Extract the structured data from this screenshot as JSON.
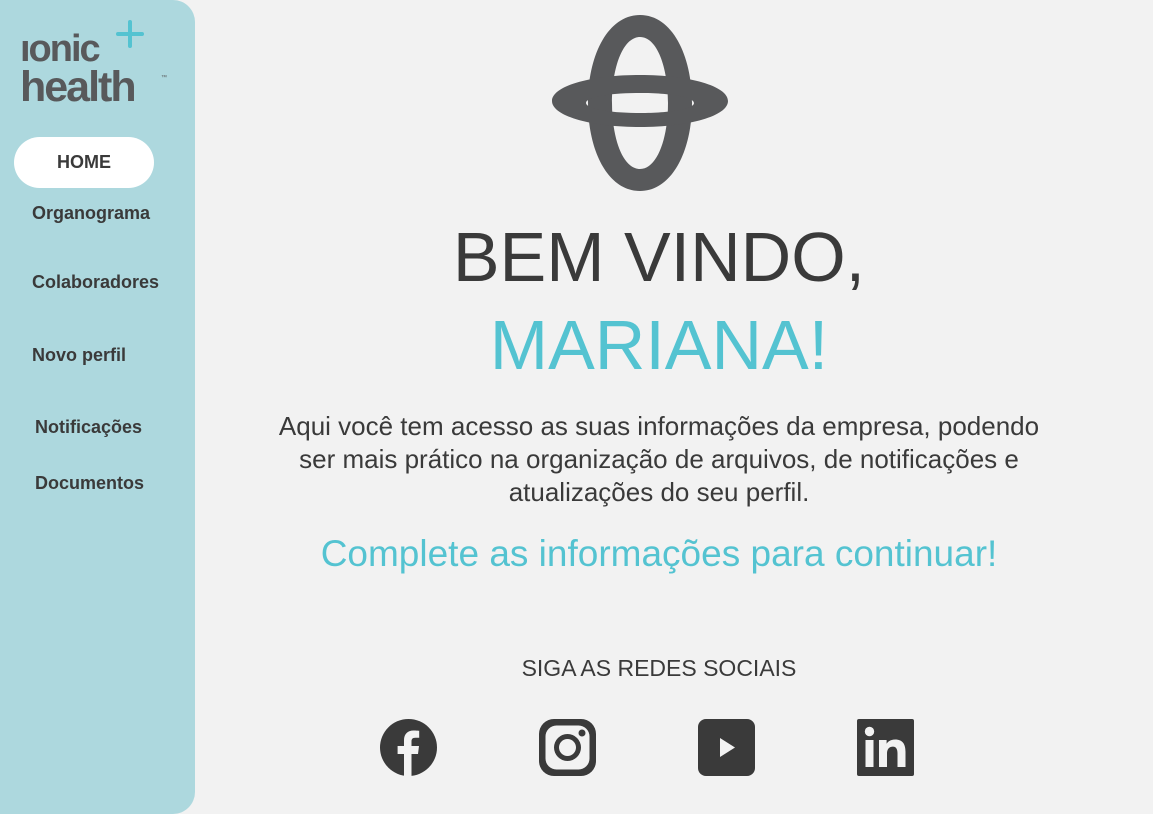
{
  "brand": {
    "logo_line1": "ıonic",
    "logo_line2": "health",
    "trademark": "™",
    "logo_text_color": "#58595b",
    "accent_color": "#54c3d1"
  },
  "sidebar": {
    "background_color": "#add8de",
    "items": [
      {
        "label": "HOME",
        "active": true
      },
      {
        "label": "Organograma"
      },
      {
        "label": "Colaboradores"
      },
      {
        "label": "Novo perfil"
      },
      {
        "label": "Notificações"
      },
      {
        "label": "Documentos"
      }
    ]
  },
  "main": {
    "emblem_icon": "ionic-health-emblem-icon",
    "welcome_line1": "BEM VINDO,",
    "welcome_line2": "MARIANA!",
    "description_lines": [
      "Aqui você tem acesso as suas informações da empresa, podendo",
      "ser mais prático na organização de arquivos, de notificações e",
      "atualizações do seu perfil."
    ],
    "cta": "Complete as informações para continuar!",
    "social_title": "SIGA AS REDES SOCIAIS",
    "social_icons": [
      "facebook-icon",
      "instagram-icon",
      "youtube-icon",
      "linkedin-icon"
    ],
    "text_color": "#3a3a3a",
    "background_color": "#f2f2f2"
  }
}
